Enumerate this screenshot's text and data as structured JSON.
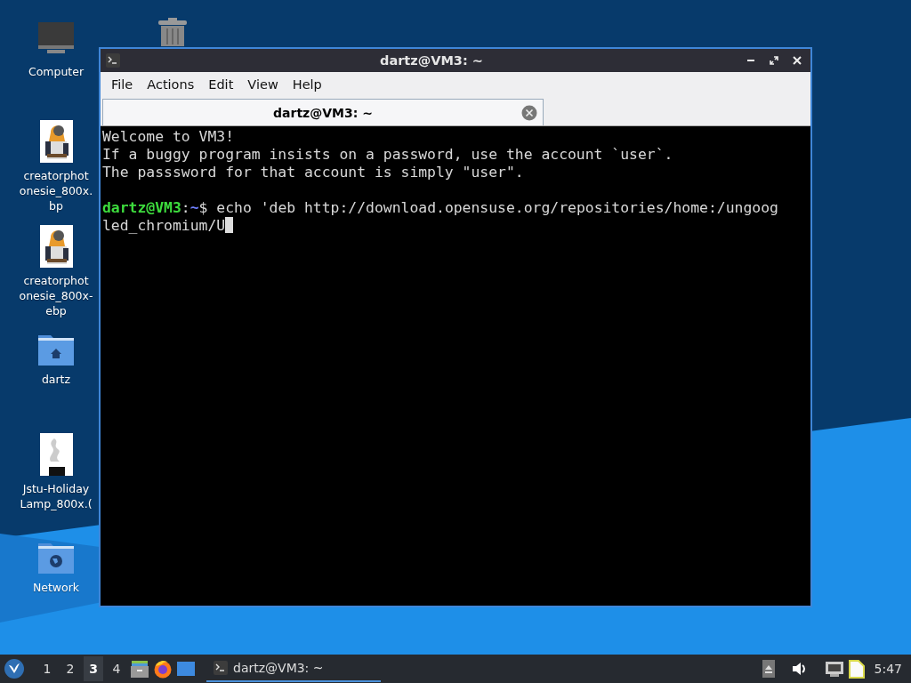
{
  "desktop_icons": [
    {
      "kind": "computer",
      "lines": [
        "Computer"
      ]
    },
    {
      "kind": "trash"
    },
    {
      "kind": "picture",
      "lines": [
        "creatorphot",
        "onesie_800x.",
        "bp"
      ]
    },
    {
      "kind": "picture",
      "lines": [
        "creatorphot",
        "onesie_800x-",
        "ebp"
      ]
    },
    {
      "kind": "home-folder",
      "lines": [
        "dartz"
      ]
    },
    {
      "kind": "lamp-picture",
      "lines": [
        "Jstu-Holiday",
        "Lamp_800x.("
      ]
    },
    {
      "kind": "network-folder",
      "lines": [
        "Network"
      ]
    }
  ],
  "window": {
    "title": "dartz@VM3: ~",
    "menu": [
      "File",
      "Actions",
      "Edit",
      "View",
      "Help"
    ],
    "tabs": [
      {
        "label": "dartz@VM3: ~",
        "selected": true
      }
    ],
    "terminal": [
      {
        "kind": "text",
        "text": "Welcome to VM3!"
      },
      {
        "kind": "text",
        "text": "If a buggy program insists on a password, use the account `user`."
      },
      {
        "kind": "text",
        "text": "The passsword for that account is simply \"user\"."
      },
      {
        "kind": "blank"
      },
      {
        "kind": "prompt",
        "user": "dartz@VM3",
        "sep": ":",
        "path": "~",
        "sign": "$",
        "command": "echo 'deb http://download.opensuse.org/repositories/home:/ungoog"
      },
      {
        "kind": "input",
        "text": "led_chromium/U"
      }
    ]
  },
  "taskbar": {
    "workspaces": [
      {
        "label": "1",
        "selected": false
      },
      {
        "label": "2",
        "selected": false
      },
      {
        "label": "3",
        "selected": true
      },
      {
        "label": "4",
        "selected": false
      }
    ],
    "tasks": [
      {
        "label": "dartz@VM3: ~",
        "selected": true
      }
    ],
    "clock": "5:47"
  }
}
